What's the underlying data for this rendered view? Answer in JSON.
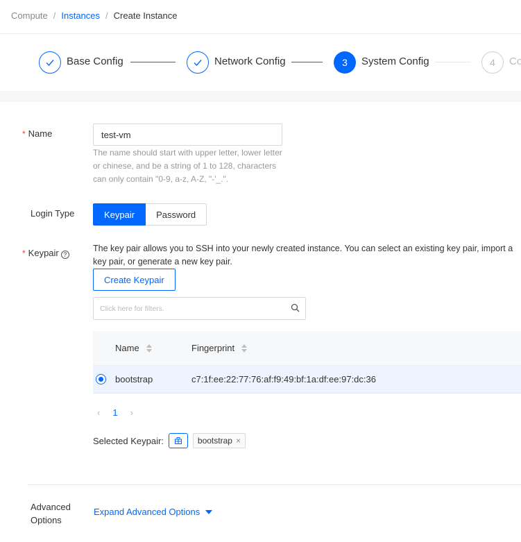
{
  "breadcrumb": {
    "root": "Compute",
    "parent": "Instances",
    "current": "Create Instance",
    "sep": "/"
  },
  "steps": [
    {
      "label": "Base Config",
      "status": "done"
    },
    {
      "label": "Network Config",
      "status": "done"
    },
    {
      "label": "System Config",
      "number": "3",
      "status": "active"
    },
    {
      "label": "Co",
      "number": "4",
      "status": "wait"
    }
  ],
  "form": {
    "name": {
      "required_mark": "*",
      "label": "Name",
      "value": "test-vm",
      "help": "The name should start with upper letter, lower letter or chinese, and be a string of 1 to 128, characters can only contain \"0-9, a-z, A-Z, \"-'_.\"."
    },
    "login_type": {
      "label": "Login Type",
      "options": [
        "Keypair",
        "Password"
      ],
      "selected": "Keypair"
    },
    "keypair": {
      "required_mark": "*",
      "label": "Keypair",
      "help_glyph": "?",
      "description": "The key pair allows you to SSH into your newly created instance. You can select an existing key pair, import a key pair, or generate a new key pair.",
      "create_button": "Create Keypair",
      "filter_placeholder": "Click here for filters.",
      "table": {
        "columns": [
          "Name",
          "Fingerprint"
        ],
        "rows": [
          {
            "name": "bootstrap",
            "fingerprint": "c7:1f:ee:22:77:76:af:f9:49:bf:1a:df:ee:97:dc:36",
            "selected": true
          }
        ]
      },
      "pagination": {
        "prev": "‹",
        "page": "1",
        "next": "›"
      },
      "selected_label": "Selected Keypair:",
      "selected_tag": "bootstrap",
      "tag_close": "×"
    },
    "advanced": {
      "label": "Advanced Options",
      "link": "Expand Advanced Options"
    }
  },
  "colors": {
    "primary": "#0068ff",
    "required": "#e8423a"
  },
  "icons": [
    "check-icon",
    "help-icon",
    "search-icon",
    "keypair-icon",
    "close-icon",
    "caret-down-icon",
    "sort-icon"
  ]
}
